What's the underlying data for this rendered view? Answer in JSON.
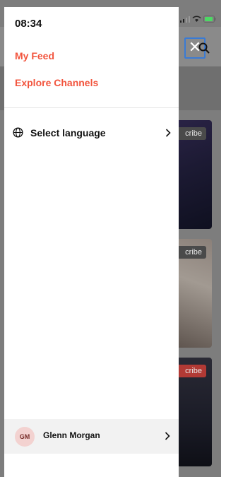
{
  "status_bar": {
    "time": "08:34"
  },
  "menu": {
    "links": [
      {
        "label": "My Feed"
      },
      {
        "label": "Explore Channels"
      }
    ],
    "language": {
      "label": "Select language"
    }
  },
  "profile": {
    "initials": "GM",
    "name": "Glenn Morgan"
  },
  "background": {
    "subscribe_buttons": [
      {
        "label": "cribe"
      },
      {
        "label": "cribe"
      },
      {
        "label": "cribe"
      }
    ],
    "close_glyph": "✕"
  },
  "colors": {
    "accent": "#f2543d",
    "focus_outline": "#3a7bd5"
  }
}
